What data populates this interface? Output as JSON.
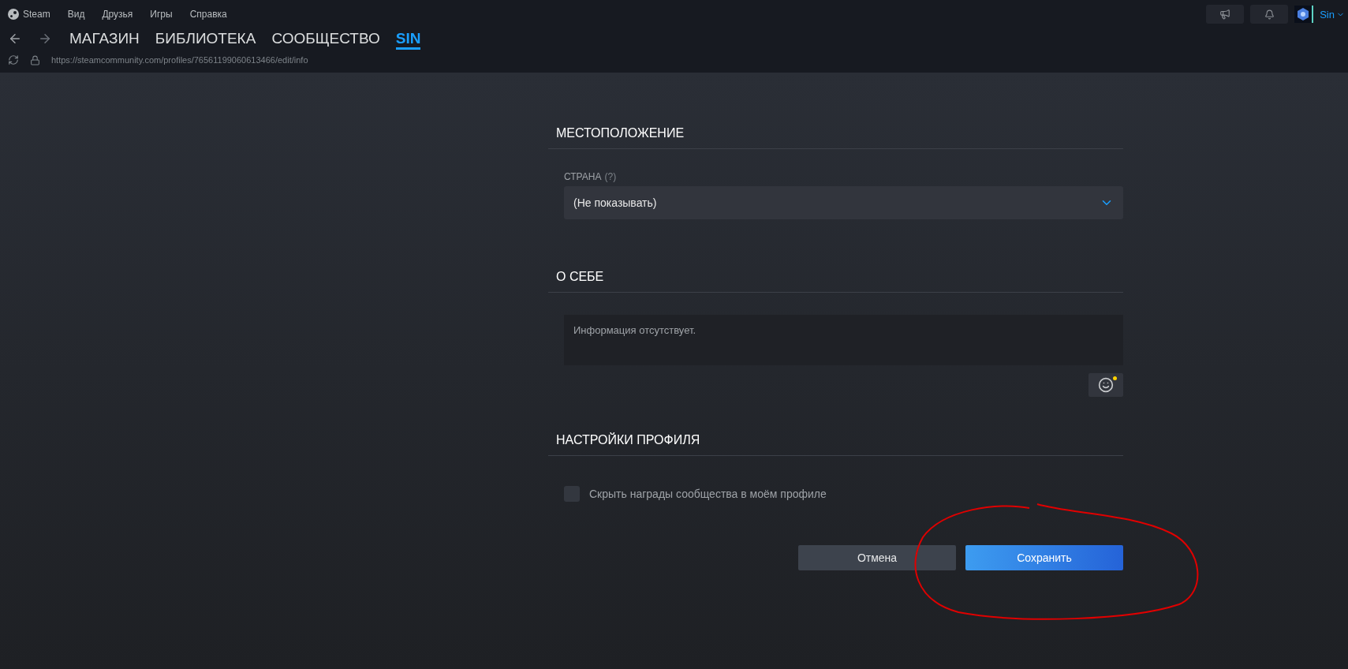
{
  "menu": [
    "Steam",
    "Вид",
    "Друзья",
    "Игры",
    "Справка"
  ],
  "nav": [
    {
      "label": "МАГАЗИН",
      "selected": false
    },
    {
      "label": "БИБЛИОТЕКА",
      "selected": false
    },
    {
      "label": "СООБЩЕСТВО",
      "selected": false
    },
    {
      "label": "SIN",
      "selected": true
    }
  ],
  "url": "https://steamcommunity.com/profiles/76561199060613466/edit/info",
  "user": {
    "name": "Sin"
  },
  "location": {
    "title": "МЕСТОПОЛОЖЕНИЕ",
    "country_label": "СТРАНА",
    "country_help": "(?)",
    "country_value": "(Не показывать)"
  },
  "about": {
    "title": "О СЕБЕ",
    "placeholder": "Информация отсутствует."
  },
  "settings": {
    "title": "НАСТРОЙКИ ПРОФИЛЯ",
    "options": [
      {
        "label": "Скрыть награды сообщества в моём профиле",
        "checked": false
      }
    ]
  },
  "buttons": [
    {
      "label": "Отмена",
      "kind": "secondary"
    },
    {
      "label": "Сохранить",
      "kind": "primary"
    }
  ],
  "annotation": {
    "kind": "circle"
  }
}
